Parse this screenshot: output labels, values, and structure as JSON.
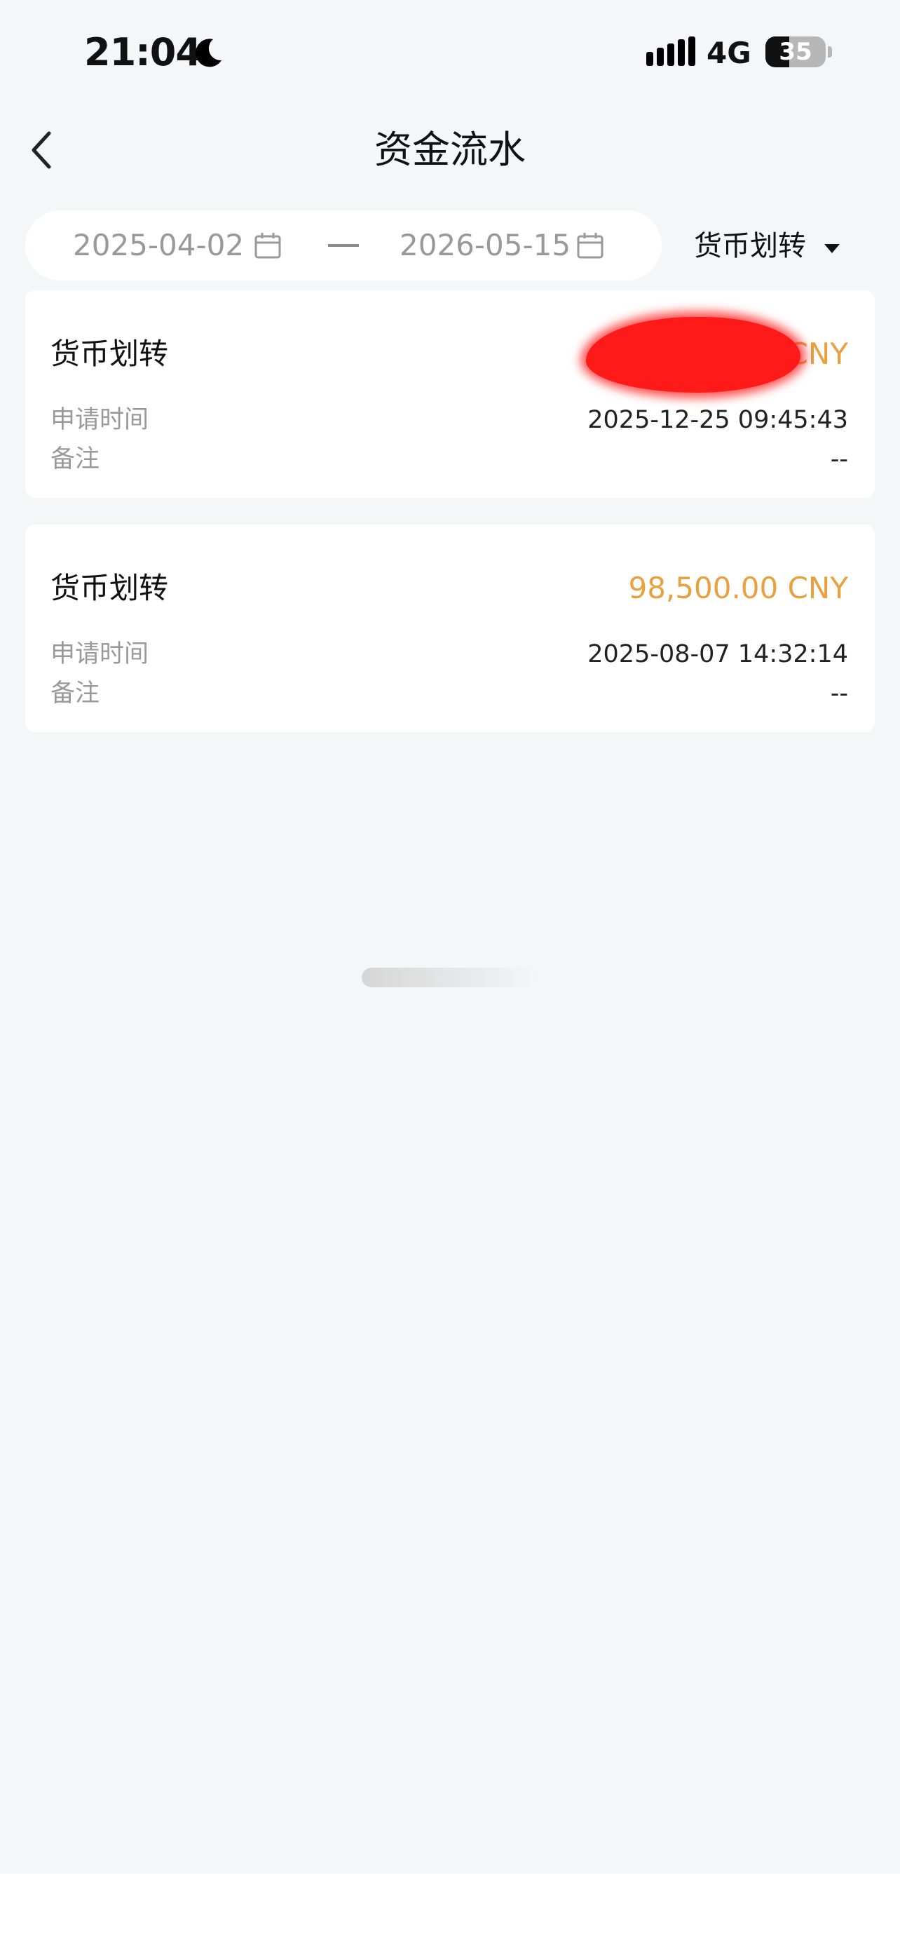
{
  "status_bar": {
    "time": "21:04",
    "network": "4G",
    "battery": "35"
  },
  "header": {
    "title": "资金流水"
  },
  "filters": {
    "start_date": "2025-04-02",
    "end_date": "2026-05-15",
    "type": "货币划转"
  },
  "records": [
    {
      "title": "货币划转",
      "amount": "CNY",
      "time_label": "申请时间",
      "time": "2025-12-25 09:45:43",
      "remark_label": "备注",
      "remark": "--"
    },
    {
      "title": "货币划转",
      "amount": "98,500.00 CNY",
      "time_label": "申请时间",
      "time": "2025-08-07 14:32:14",
      "remark_label": "备注",
      "remark": "--"
    }
  ],
  "colors": {
    "amount": "#e9a03f",
    "background": "#f5f6f8",
    "card": "#ffffff",
    "muted": "#999999",
    "redaction": "#ff1a1a"
  },
  "icons": [
    "moon-icon",
    "signal-icon",
    "back-chevron-icon",
    "calendar-icon",
    "caret-down-icon"
  ]
}
